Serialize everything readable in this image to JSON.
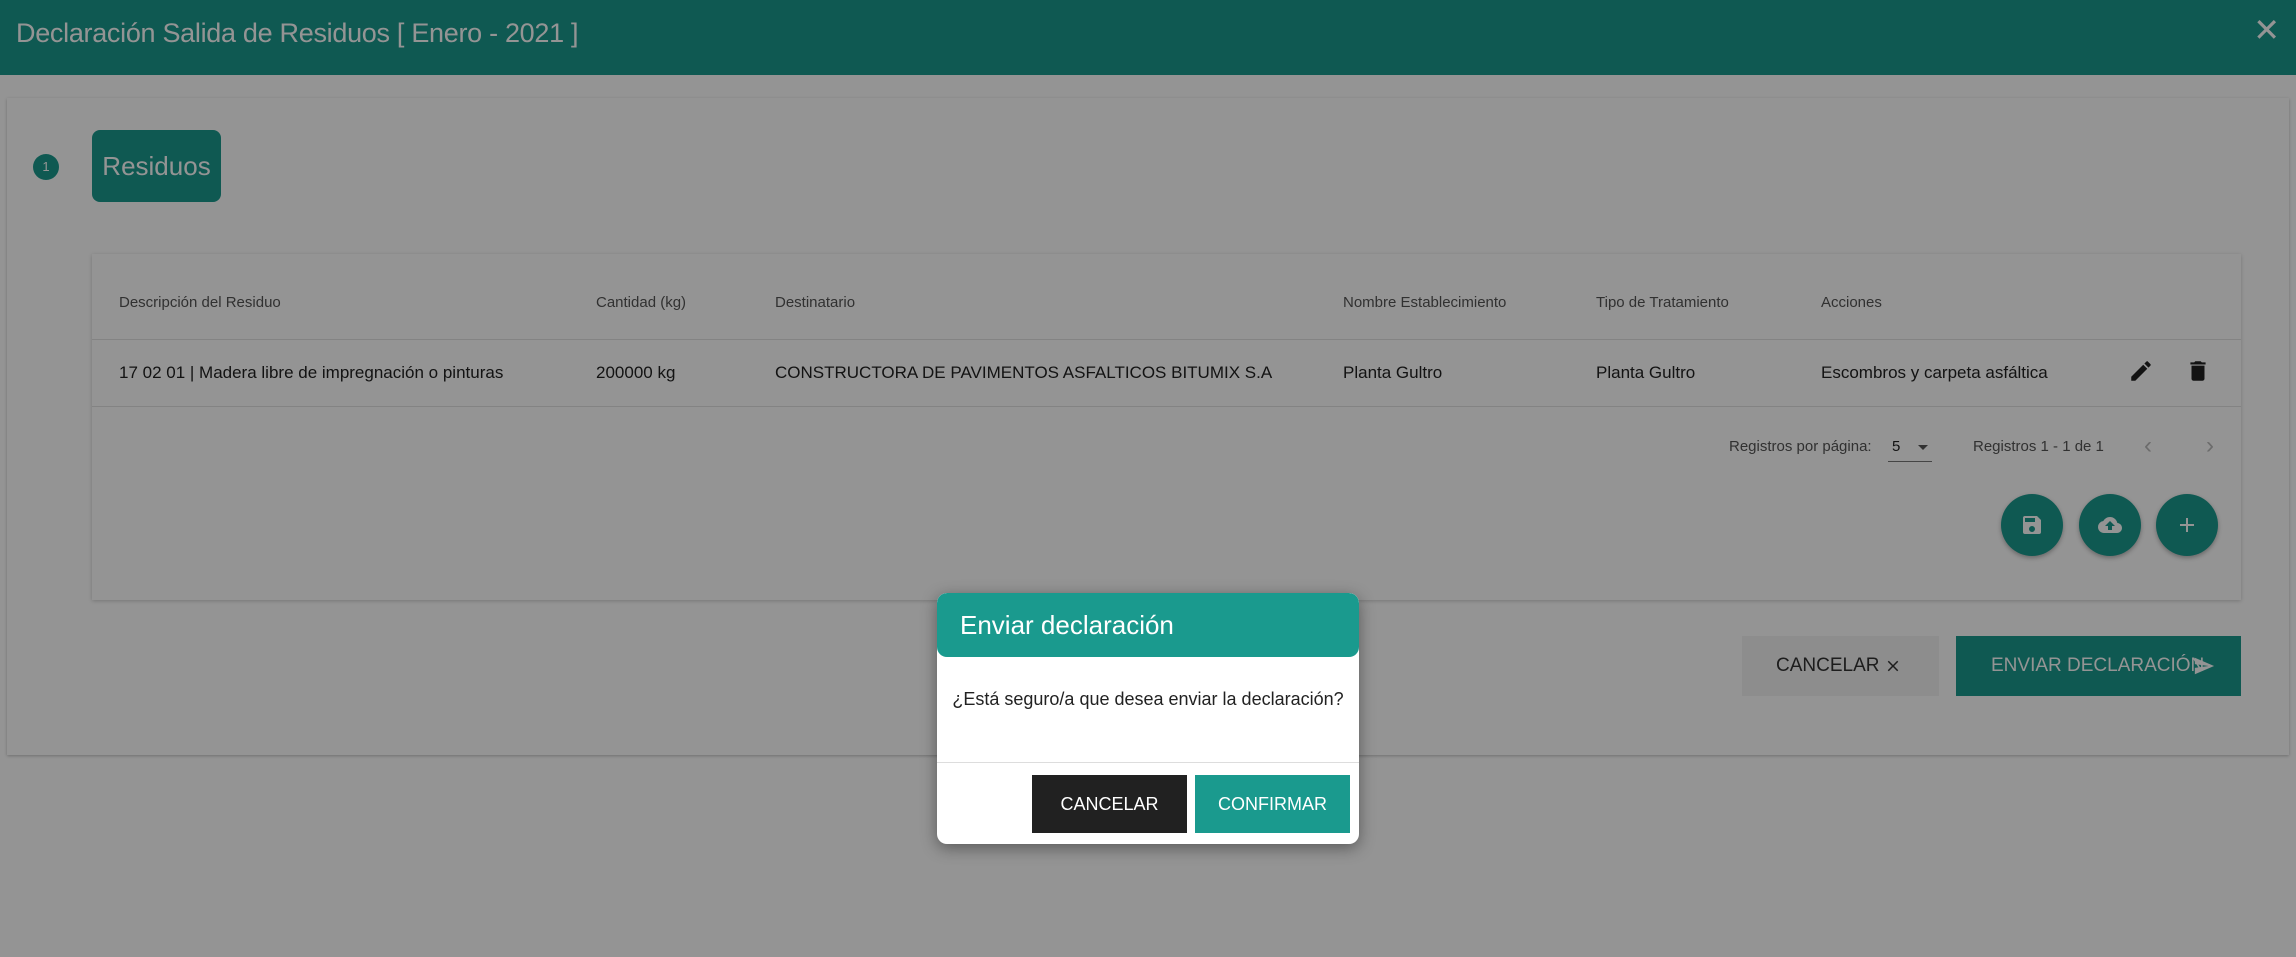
{
  "header": {
    "title": "Declaración Salida de Residuos [ Enero - 2021 ]",
    "close_glyph": "✕"
  },
  "stepper": {
    "step_number": "1",
    "step_label": "Residuos"
  },
  "table": {
    "headers": [
      "Descripción del Residuo",
      "Cantidad (kg)",
      "Destinatario",
      "Nombre Establecimiento",
      "Tipo de Tratamiento",
      "Acciones"
    ],
    "rows": [
      [
        "17 02 01 | Madera libre de impregnación o pinturas",
        "200000 kg",
        "CONSTRUCTORA DE PAVIMENTOS ASFALTICOS BITUMIX S.A",
        "Planta Gultro",
        "Planta Gultro",
        "Escombros y carpeta asfáltica"
      ]
    ],
    "row_actions": [
      "pencil-icon",
      "trash-icon"
    ]
  },
  "pagination": {
    "per_page_label": "Registros por página:",
    "per_page_value": "5",
    "range_label": "Registros 1 - 1 de 1",
    "prev_glyph": "‹",
    "next_glyph": "›"
  },
  "fabs": [
    "save-icon",
    "cloud-upload-icon",
    "plus-icon"
  ],
  "actions": {
    "cancel_label": "CANCELAR",
    "send_label": "ENVIAR DECLARACIÓN"
  },
  "dialog": {
    "title": "Enviar declaración",
    "message": "¿Está seguro/a que desea enviar la declaración?",
    "cancel_label": "CANCELAR",
    "confirm_label": "CONFIRMAR"
  },
  "colors": {
    "primary": "#1a9a8e",
    "dark_button": "#212121",
    "overlay": "rgba(0,0,0,0.42)"
  }
}
